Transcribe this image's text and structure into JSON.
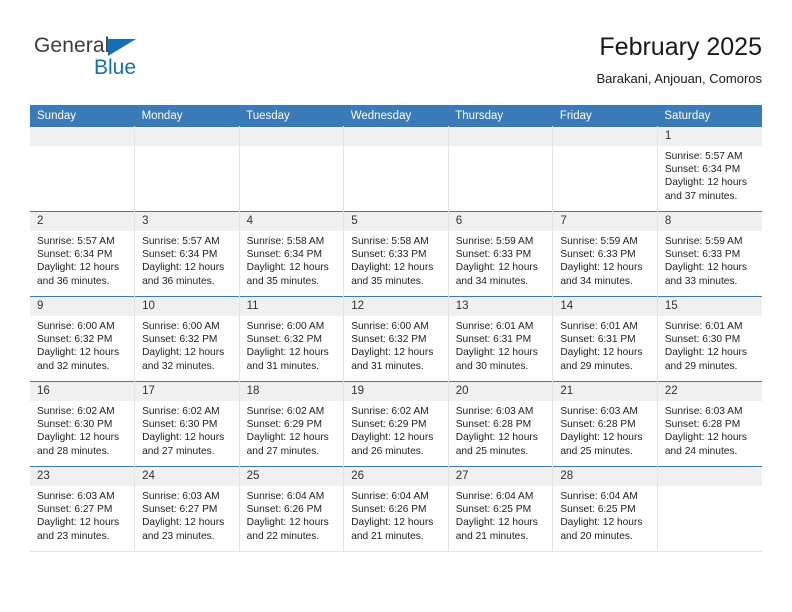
{
  "logo": {
    "word1": "General",
    "word2": "Blue",
    "triangle_color": "#1270b8"
  },
  "header": {
    "title": "February 2025",
    "subtitle": "Barakani, Anjouan, Comoros"
  },
  "theme": {
    "header_bg": "#3a7ab8",
    "daynum_bg": "#f0f0f0",
    "grid_line": "#e4e4e4"
  },
  "weekdays": [
    "Sunday",
    "Monday",
    "Tuesday",
    "Wednesday",
    "Thursday",
    "Friday",
    "Saturday"
  ],
  "labels": {
    "sunrise_prefix": "Sunrise:",
    "sunset_prefix": "Sunset:",
    "daylight_prefix": "Daylight:"
  },
  "weeks": [
    [
      {
        "day": "",
        "empty": true
      },
      {
        "day": "",
        "empty": true
      },
      {
        "day": "",
        "empty": true
      },
      {
        "day": "",
        "empty": true
      },
      {
        "day": "",
        "empty": true
      },
      {
        "day": "",
        "empty": true
      },
      {
        "day": "1",
        "sunrise": "Sunrise: 5:57 AM",
        "sunset": "Sunset: 6:34 PM",
        "daylight1": "Daylight: 12 hours",
        "daylight2": "and 37 minutes."
      }
    ],
    [
      {
        "day": "2",
        "sunrise": "Sunrise: 5:57 AM",
        "sunset": "Sunset: 6:34 PM",
        "daylight1": "Daylight: 12 hours",
        "daylight2": "and 36 minutes."
      },
      {
        "day": "3",
        "sunrise": "Sunrise: 5:57 AM",
        "sunset": "Sunset: 6:34 PM",
        "daylight1": "Daylight: 12 hours",
        "daylight2": "and 36 minutes."
      },
      {
        "day": "4",
        "sunrise": "Sunrise: 5:58 AM",
        "sunset": "Sunset: 6:34 PM",
        "daylight1": "Daylight: 12 hours",
        "daylight2": "and 35 minutes."
      },
      {
        "day": "5",
        "sunrise": "Sunrise: 5:58 AM",
        "sunset": "Sunset: 6:33 PM",
        "daylight1": "Daylight: 12 hours",
        "daylight2": "and 35 minutes."
      },
      {
        "day": "6",
        "sunrise": "Sunrise: 5:59 AM",
        "sunset": "Sunset: 6:33 PM",
        "daylight1": "Daylight: 12 hours",
        "daylight2": "and 34 minutes."
      },
      {
        "day": "7",
        "sunrise": "Sunrise: 5:59 AM",
        "sunset": "Sunset: 6:33 PM",
        "daylight1": "Daylight: 12 hours",
        "daylight2": "and 34 minutes."
      },
      {
        "day": "8",
        "sunrise": "Sunrise: 5:59 AM",
        "sunset": "Sunset: 6:33 PM",
        "daylight1": "Daylight: 12 hours",
        "daylight2": "and 33 minutes."
      }
    ],
    [
      {
        "day": "9",
        "sunrise": "Sunrise: 6:00 AM",
        "sunset": "Sunset: 6:32 PM",
        "daylight1": "Daylight: 12 hours",
        "daylight2": "and 32 minutes."
      },
      {
        "day": "10",
        "sunrise": "Sunrise: 6:00 AM",
        "sunset": "Sunset: 6:32 PM",
        "daylight1": "Daylight: 12 hours",
        "daylight2": "and 32 minutes."
      },
      {
        "day": "11",
        "sunrise": "Sunrise: 6:00 AM",
        "sunset": "Sunset: 6:32 PM",
        "daylight1": "Daylight: 12 hours",
        "daylight2": "and 31 minutes."
      },
      {
        "day": "12",
        "sunrise": "Sunrise: 6:00 AM",
        "sunset": "Sunset: 6:32 PM",
        "daylight1": "Daylight: 12 hours",
        "daylight2": "and 31 minutes."
      },
      {
        "day": "13",
        "sunrise": "Sunrise: 6:01 AM",
        "sunset": "Sunset: 6:31 PM",
        "daylight1": "Daylight: 12 hours",
        "daylight2": "and 30 minutes."
      },
      {
        "day": "14",
        "sunrise": "Sunrise: 6:01 AM",
        "sunset": "Sunset: 6:31 PM",
        "daylight1": "Daylight: 12 hours",
        "daylight2": "and 29 minutes."
      },
      {
        "day": "15",
        "sunrise": "Sunrise: 6:01 AM",
        "sunset": "Sunset: 6:30 PM",
        "daylight1": "Daylight: 12 hours",
        "daylight2": "and 29 minutes."
      }
    ],
    [
      {
        "day": "16",
        "sunrise": "Sunrise: 6:02 AM",
        "sunset": "Sunset: 6:30 PM",
        "daylight1": "Daylight: 12 hours",
        "daylight2": "and 28 minutes."
      },
      {
        "day": "17",
        "sunrise": "Sunrise: 6:02 AM",
        "sunset": "Sunset: 6:30 PM",
        "daylight1": "Daylight: 12 hours",
        "daylight2": "and 27 minutes."
      },
      {
        "day": "18",
        "sunrise": "Sunrise: 6:02 AM",
        "sunset": "Sunset: 6:29 PM",
        "daylight1": "Daylight: 12 hours",
        "daylight2": "and 27 minutes."
      },
      {
        "day": "19",
        "sunrise": "Sunrise: 6:02 AM",
        "sunset": "Sunset: 6:29 PM",
        "daylight1": "Daylight: 12 hours",
        "daylight2": "and 26 minutes."
      },
      {
        "day": "20",
        "sunrise": "Sunrise: 6:03 AM",
        "sunset": "Sunset: 6:28 PM",
        "daylight1": "Daylight: 12 hours",
        "daylight2": "and 25 minutes."
      },
      {
        "day": "21",
        "sunrise": "Sunrise: 6:03 AM",
        "sunset": "Sunset: 6:28 PM",
        "daylight1": "Daylight: 12 hours",
        "daylight2": "and 25 minutes."
      },
      {
        "day": "22",
        "sunrise": "Sunrise: 6:03 AM",
        "sunset": "Sunset: 6:28 PM",
        "daylight1": "Daylight: 12 hours",
        "daylight2": "and 24 minutes."
      }
    ],
    [
      {
        "day": "23",
        "sunrise": "Sunrise: 6:03 AM",
        "sunset": "Sunset: 6:27 PM",
        "daylight1": "Daylight: 12 hours",
        "daylight2": "and 23 minutes."
      },
      {
        "day": "24",
        "sunrise": "Sunrise: 6:03 AM",
        "sunset": "Sunset: 6:27 PM",
        "daylight1": "Daylight: 12 hours",
        "daylight2": "and 23 minutes."
      },
      {
        "day": "25",
        "sunrise": "Sunrise: 6:04 AM",
        "sunset": "Sunset: 6:26 PM",
        "daylight1": "Daylight: 12 hours",
        "daylight2": "and 22 minutes."
      },
      {
        "day": "26",
        "sunrise": "Sunrise: 6:04 AM",
        "sunset": "Sunset: 6:26 PM",
        "daylight1": "Daylight: 12 hours",
        "daylight2": "and 21 minutes."
      },
      {
        "day": "27",
        "sunrise": "Sunrise: 6:04 AM",
        "sunset": "Sunset: 6:25 PM",
        "daylight1": "Daylight: 12 hours",
        "daylight2": "and 21 minutes."
      },
      {
        "day": "28",
        "sunrise": "Sunrise: 6:04 AM",
        "sunset": "Sunset: 6:25 PM",
        "daylight1": "Daylight: 12 hours",
        "daylight2": "and 20 minutes."
      },
      {
        "day": "",
        "empty": true
      }
    ]
  ]
}
